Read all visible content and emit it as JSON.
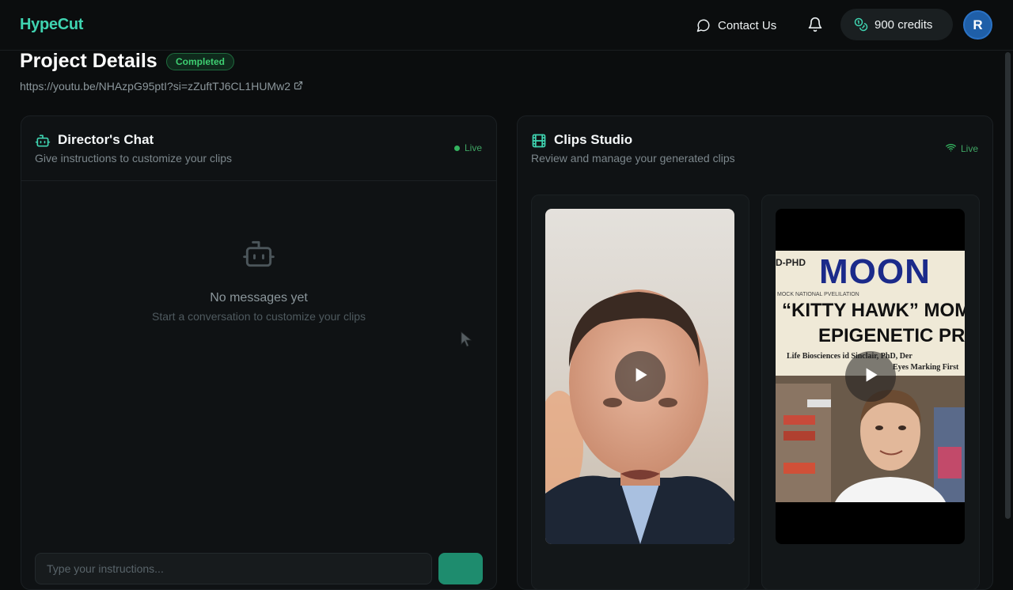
{
  "header": {
    "logo": "HypeCut",
    "contact_label": "Contact Us",
    "credits_label": "900 credits",
    "avatar_initial": "R",
    "icons": {
      "contact": "chat-bubble-icon",
      "bell": "bell-icon",
      "credits": "coins-icon"
    },
    "colors": {
      "brand": "#3fd3b0",
      "avatar": "#1f5fa8"
    }
  },
  "project": {
    "title": "Project Details",
    "status": "Completed",
    "source_url": "https://youtu.be/NHAzpG95ptI?si=zZuftTJ6CL1HUMw2",
    "status_color": "#3ecf72"
  },
  "chat": {
    "title": "Director's Chat",
    "subtitle": "Give instructions to customize your clips",
    "live_label": "Live",
    "empty_title": "No messages yet",
    "empty_subtitle": "Start a conversation to customize your clips",
    "input_placeholder": "Type your instructions...",
    "icons": {
      "header": "bot-icon",
      "empty": "bot-icon",
      "send": "send-icon"
    }
  },
  "studio": {
    "title": "Clips Studio",
    "subtitle": "Review and manage your generated clips",
    "live_label": "Live",
    "icons": {
      "header": "film-icon",
      "live": "wifi-icon",
      "play": "play-icon"
    },
    "clips": [
      {
        "name": "clip-1"
      },
      {
        "name": "clip-2",
        "poster": {
          "corner": "D-PHD",
          "masthead": "MOON",
          "kicker": "MOCK NATIONAL PVELILATION",
          "headline_1": "“KITTY HAWK” MOMEN",
          "headline_2": "EPIGENETIC PRO",
          "byline_1": "Life Biosciences   id Sinclair, PhD, Der",
          "byline_2": "Eyes Marking First"
        }
      }
    ]
  }
}
